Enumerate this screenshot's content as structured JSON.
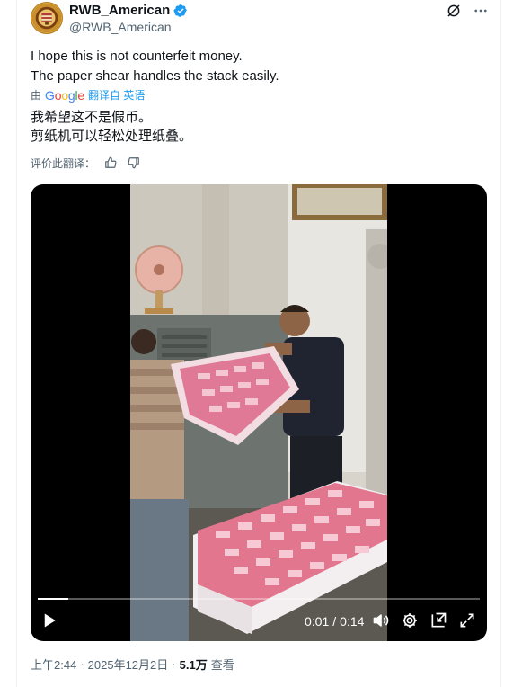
{
  "author": {
    "name": "RWB_American",
    "handle": "@RWB_American",
    "avatar_icon": "round-seal-avatar",
    "verified_icon": "verified-badge-icon",
    "verified_color": "#1d9bf0"
  },
  "header_actions": {
    "grok_icon": "grok-icon",
    "more_icon": "more-horizontal-icon"
  },
  "tweet": {
    "line1": "I hope this is not counterfeit money.",
    "line2": "The paper shear handles the stack easily."
  },
  "translation": {
    "by_prefix": "由",
    "google_letters": [
      "G",
      "o",
      "o",
      "g",
      "l",
      "e"
    ],
    "link_label": "翻译自 英语",
    "line1": "我希望这不是假币。",
    "line2": "剪纸机可以轻松处理纸叠。",
    "rate_label": "评价此翻译：",
    "thumb_up_icon": "thumbs-up-icon",
    "thumb_down_icon": "thumbs-down-icon"
  },
  "video": {
    "current_time": "0:01",
    "separator": "/",
    "duration": "0:14",
    "progress_fraction": 0.07,
    "play_icon": "play-icon",
    "volume_icon": "volume-icon",
    "settings_icon": "settings-gear-icon",
    "pip_icon": "picture-in-picture-icon",
    "fullscreen_icon": "fullscreen-icon"
  },
  "meta": {
    "time": "上午2:44",
    "dot1": "·",
    "date": "2025年12月2日",
    "dot2": "·",
    "views_count": "5.1万",
    "views_label": "查看"
  },
  "colors": {
    "text_primary": "#0f1419",
    "text_secondary": "#536471",
    "link": "#1d9bf0",
    "banknote_pink": "#e26f8a"
  }
}
